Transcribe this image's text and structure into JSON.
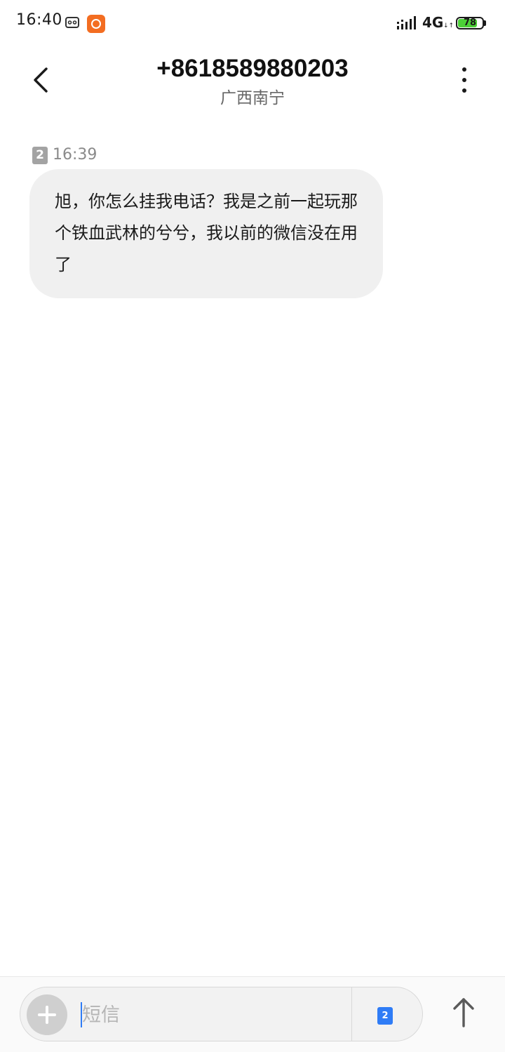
{
  "status_bar": {
    "time": "16:40",
    "network": "4G",
    "network_arrows": "↓↑",
    "battery_level": "78",
    "battery_fraction": 0.78,
    "battery_color": "#4cd137",
    "app_icon_color": "#f36d21"
  },
  "header": {
    "contact_number": "+8618589880203",
    "contact_location": "广西南宁",
    "back_icon": "chevron-left-icon",
    "more_icon": "more-vertical-icon"
  },
  "conversation": {
    "messages": [
      {
        "sim_slot": "2",
        "time": "16:39",
        "text": "旭，你怎么挂我电话？我是之前一起玩那个铁血武林的兮兮，我以前的微信没在用了",
        "bubble_color": "#f0f0f0"
      }
    ]
  },
  "compose": {
    "placeholder": "短信",
    "value": "",
    "sim_slot": "2",
    "sim_color": "#2f7cf6",
    "attach_icon": "plus-icon",
    "send_icon": "arrow-up-icon"
  }
}
